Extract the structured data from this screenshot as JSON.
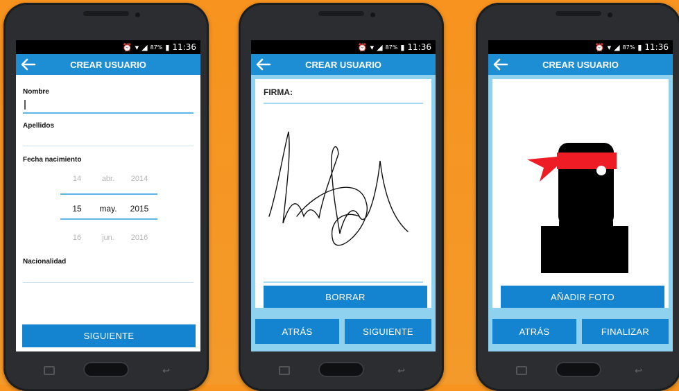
{
  "status": {
    "battery": "87%",
    "time": "11:36"
  },
  "screen1": {
    "title": "CREAR USUARIO",
    "name_label": "Nombre",
    "surname_label": "Apellidos",
    "birth_label": "Fecha nacimiento",
    "date_picker": {
      "prev": {
        "day": "14",
        "month": "abr.",
        "year": "2014"
      },
      "selected": {
        "day": "15",
        "month": "may.",
        "year": "2015"
      },
      "next": {
        "day": "16",
        "month": "jun.",
        "year": "2016"
      }
    },
    "nationality_label": "Nacionalidad",
    "next_button": "SIGUIENTE"
  },
  "screen2": {
    "title": "CREAR USUARIO",
    "signature_label": "FIRMA:",
    "clear_button": "BORRAR",
    "back_button": "ATRÁS",
    "next_button": "SIGUIENTE"
  },
  "screen3": {
    "title": "CREAR USUARIO",
    "add_photo_button": "AÑADIR FOTO",
    "back_button": "ATRÁS",
    "finish_button": "FINALIZAR"
  },
  "colors": {
    "background": "#f7931e",
    "primary": "#1d8ed4",
    "button": "#1584d0",
    "frame": "#8fd2f0"
  },
  "icons": [
    "back-arrow-icon",
    "alarm-icon",
    "wifi-icon",
    "signal-icon",
    "battery-icon",
    "recent-apps-icon",
    "home-icon",
    "back-nav-icon",
    "ninja-avatar-icon"
  ]
}
